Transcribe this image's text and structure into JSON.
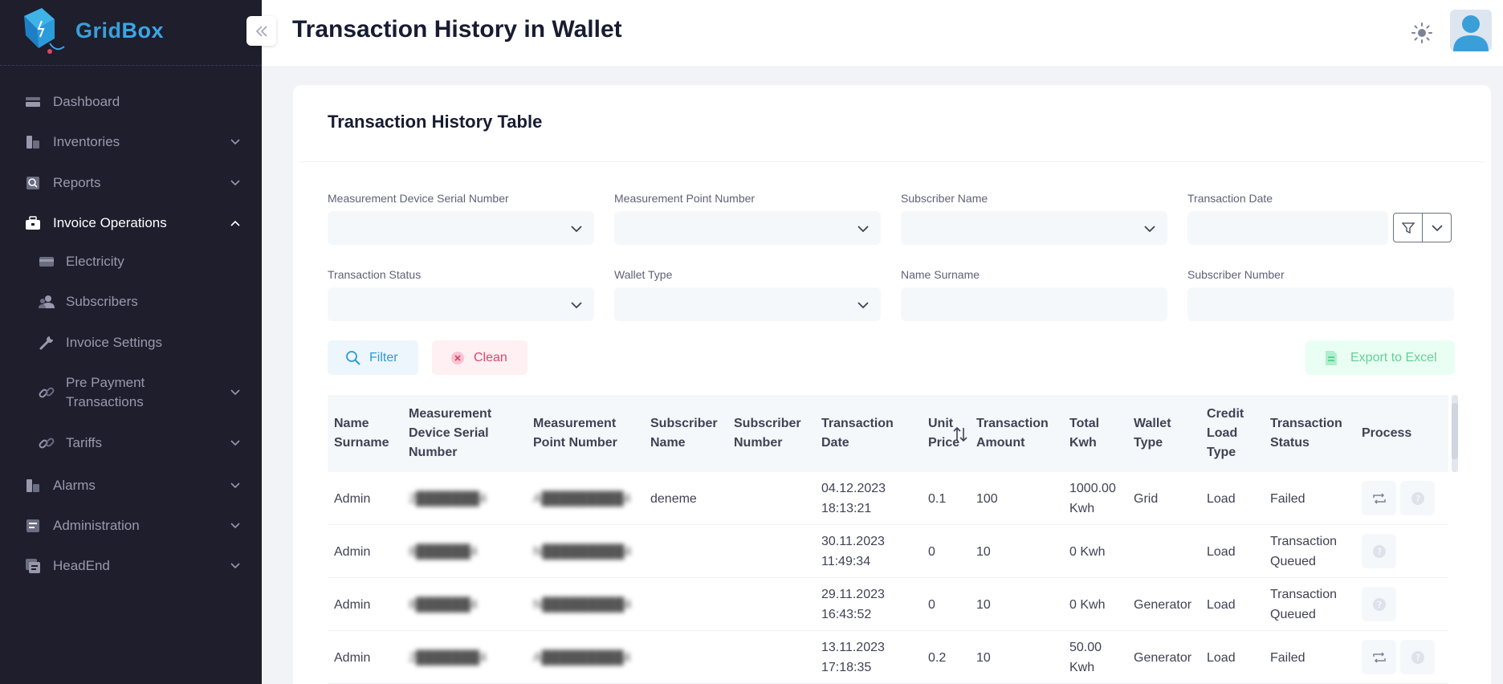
{
  "app": {
    "brand_part1": "Grid",
    "brand_part2": "Box"
  },
  "sidebar": {
    "items": [
      {
        "label": "Dashboard"
      },
      {
        "label": "Inventories"
      },
      {
        "label": "Reports"
      },
      {
        "label": "Invoice Operations"
      },
      {
        "label": "Electricity"
      },
      {
        "label": "Subscribers"
      },
      {
        "label": "Invoice Settings"
      },
      {
        "label": "Pre Payment"
      },
      {
        "label": "Transactions"
      },
      {
        "label": "Tariffs"
      },
      {
        "label": "Alarms"
      },
      {
        "label": "Administration"
      },
      {
        "label": "HeadEnd"
      }
    ]
  },
  "header": {
    "title": "Transaction History in Wallet"
  },
  "card": {
    "title": "Transaction History Table"
  },
  "filters": {
    "device_serial": {
      "label": "Measurement Device Serial Number",
      "value": ""
    },
    "point_number": {
      "label": "Measurement Point Number",
      "value": ""
    },
    "subscriber_name": {
      "label": "Subscriber Name",
      "value": ""
    },
    "transaction_date": {
      "label": "Transaction Date",
      "value": ""
    },
    "transaction_status": {
      "label": "Transaction Status",
      "value": ""
    },
    "wallet_type": {
      "label": "Wallet Type",
      "value": ""
    },
    "name_surname": {
      "label": "Name Surname",
      "value": ""
    },
    "subscriber_number": {
      "label": "Subscriber Number",
      "value": ""
    }
  },
  "buttons": {
    "filter": "Filter",
    "clean": "Clean",
    "export": "Export to Excel"
  },
  "table": {
    "headers": [
      [
        "Name",
        "Surname"
      ],
      [
        "Measurement",
        "Device Serial",
        "Number"
      ],
      [
        "Measurement",
        "Point Number"
      ],
      [
        "Subscriber",
        "Name"
      ],
      [
        "Subscriber",
        "Number"
      ],
      [
        "Transaction",
        "Date"
      ],
      [
        "Unit",
        "Price"
      ],
      [
        "Transaction",
        "Amount"
      ],
      [
        "Total",
        "Kwh"
      ],
      [
        "Wallet",
        "Type"
      ],
      [
        "Credit",
        "Load",
        "Type"
      ],
      [
        "Transaction",
        "Status"
      ],
      [
        "Process"
      ]
    ],
    "rows": [
      {
        "name": "Admin",
        "serial": "2███████4",
        "point": "A█████████4",
        "sub_name": "deneme",
        "sub_number": "",
        "date1": "04.12.2023",
        "date2": "18:13:21",
        "unit": "0.1",
        "amount": "100",
        "kwh1": "1000.00",
        "kwh2": "Kwh",
        "wallet": "Grid",
        "credit": "Load",
        "status1": "Failed",
        "status2": "",
        "actions": [
          "retry",
          "help"
        ]
      },
      {
        "name": "Admin",
        "serial": "8██████4",
        "point": "N█████████4",
        "sub_name": "",
        "sub_number": "",
        "date1": "30.11.2023",
        "date2": "11:49:34",
        "unit": "0",
        "amount": "10",
        "kwh1": "0 Kwh",
        "kwh2": "",
        "wallet": "",
        "credit": "Load",
        "status1": "Transaction",
        "status2": "Queued",
        "actions": [
          "help"
        ]
      },
      {
        "name": "Admin",
        "serial": "8██████4",
        "point": "N█████████4",
        "sub_name": "",
        "sub_number": "",
        "date1": "29.11.2023",
        "date2": "16:43:52",
        "unit": "0",
        "amount": "10",
        "kwh1": "0 Kwh",
        "kwh2": "",
        "wallet": "Generator",
        "credit": "Load",
        "status1": "Transaction",
        "status2": "Queued",
        "actions": [
          "help"
        ]
      },
      {
        "name": "Admin",
        "serial": "2███████4",
        "point": "A█████████4",
        "sub_name": "",
        "sub_number": "",
        "date1": "13.11.2023",
        "date2": "17:18:35",
        "unit": "0.2",
        "amount": "10",
        "kwh1": "50.00",
        "kwh2": "Kwh",
        "wallet": "Generator",
        "credit": "Load",
        "status1": "Failed",
        "status2": "",
        "actions": [
          "retry",
          "help"
        ]
      }
    ]
  },
  "colors": {
    "sidebar_bg": "#1e1e2d",
    "brand": "#3a9fd8",
    "filter": "#2b9bdb",
    "clean": "#e0446b",
    "export": "#50cd89"
  }
}
